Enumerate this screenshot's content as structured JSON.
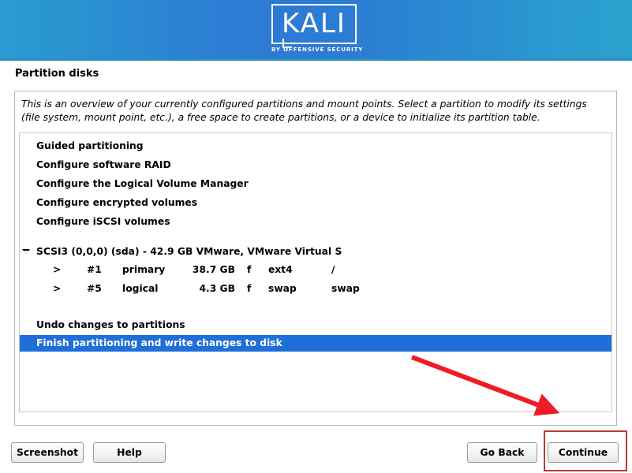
{
  "header": {
    "logo_wordmark": "KALI",
    "logo_tagline": "BY OFFENSIVE SECURITY",
    "gradient_start": "#2a9bd1",
    "gradient_mid": "#2c7ad4",
    "gradient_end": "#2ba2cf"
  },
  "page": {
    "title": "Partition disks",
    "intro": "This is an overview of your currently configured partitions and mount points. Select a partition to modify its settings (file system, mount point, etc.), a free space to create partitions, or a device to initialize its partition table."
  },
  "list": {
    "actions": [
      {
        "label": "Guided partitioning",
        "selected": false
      },
      {
        "label": "Configure software RAID",
        "selected": false
      },
      {
        "label": "Configure the Logical Volume Manager",
        "selected": false
      },
      {
        "label": "Configure encrypted volumes",
        "selected": false
      },
      {
        "label": "Configure iSCSI volumes",
        "selected": false
      }
    ],
    "disk": {
      "label": "SCSI3 (0,0,0) (sda) - 42.9 GB VMware, VMware Virtual S",
      "expanded": true,
      "chevron_icon": "triangle-down-icon",
      "partitions": [
        {
          "marker": ">",
          "number": "#1",
          "type": "primary",
          "size": "38.7 GB",
          "flag": "f",
          "filesystem": "ext4",
          "mountpoint": "/"
        },
        {
          "marker": ">",
          "number": "#5",
          "type": "logical",
          "size": "4.3 GB",
          "flag": "f",
          "filesystem": "swap",
          "mountpoint": "swap"
        }
      ]
    },
    "footer_actions": [
      {
        "label": "Undo changes to partitions",
        "selected": false
      },
      {
        "label": "Finish partitioning and write changes to disk",
        "selected": true
      }
    ],
    "selection_color": "#1e6fd9",
    "selection_text_color": "#ffffff"
  },
  "buttons": {
    "screenshot": "Screenshot",
    "help": "Help",
    "go_back": "Go Back",
    "continue": "Continue"
  },
  "annotations": {
    "highlight_color": "#c0392b",
    "arrow_color": "#ee1c25",
    "target": "Continue"
  }
}
